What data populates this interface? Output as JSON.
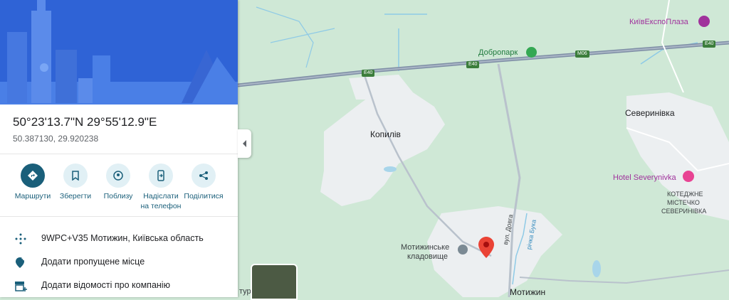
{
  "place": {
    "coordinates_dms": "50°23'13.7\"N 29°55'12.9\"E",
    "coordinates_decimal": "50.387130, 29.920238"
  },
  "actions": [
    {
      "label": "Маршрути",
      "icon": "directions-icon"
    },
    {
      "label": "Зберегти",
      "icon": "bookmark-icon"
    },
    {
      "label": "Поблизу",
      "icon": "nearby-icon"
    },
    {
      "label": "Надіслати на телефон",
      "icon": "send-to-phone-icon"
    },
    {
      "label": "Поділитися",
      "icon": "share-icon"
    }
  ],
  "info_rows": [
    {
      "text": "9WPC+V35 Мотижин, Київська область",
      "icon": "plus-code-icon"
    },
    {
      "text": "Додати пропущене місце",
      "icon": "add-place-icon"
    },
    {
      "text": "Додати відомості про компанію",
      "icon": "add-business-icon"
    }
  ],
  "map": {
    "labels": {
      "kyivexpoplaza": "КиївЕкспоПлаза",
      "dobropark": "Добропарк",
      "kopyliv": "Копилів",
      "severynivka": "Северинівка",
      "hotel": "Hotel Severynivka",
      "cottage1": "КОТЕДЖНЕ",
      "cottage2": "МІСТЕЧКО",
      "cottage3": "СЕВЕРИНІВКА",
      "cemetery1": "Мотижинське",
      "cemetery2": "кладовище",
      "motyzhyn": "Мотижин",
      "street_dovha": "вул. Довга",
      "river_buka": "річка Бука",
      "partial_left": "тур"
    },
    "shields": {
      "e40_a": "E40",
      "e40_b": "E40",
      "m06": "M06",
      "e40_c": "E40"
    }
  },
  "colors": {
    "accent": "#1a5f7a",
    "pin": "#ea4335",
    "poi": "#a0329c",
    "hero": "#2f63d6"
  }
}
